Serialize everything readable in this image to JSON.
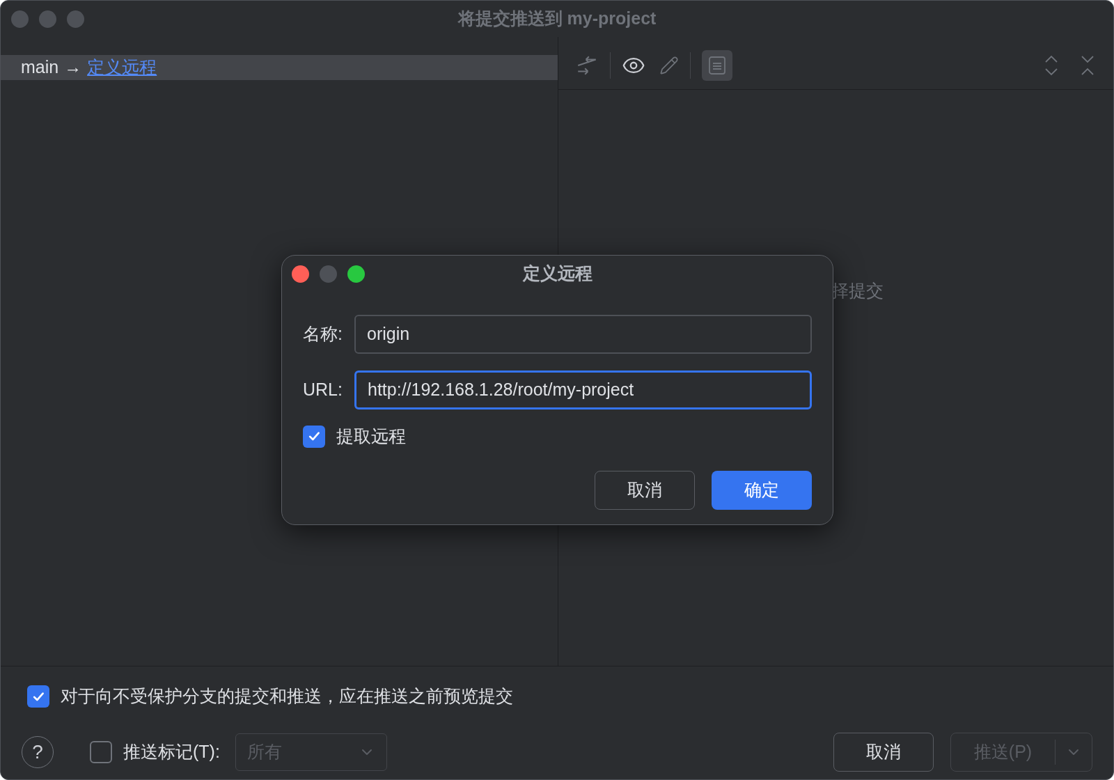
{
  "window": {
    "title": "将提交推送到 my-project"
  },
  "push_tree": {
    "rows": [
      {
        "branch": "main",
        "arrow": "→",
        "target": "定义远程",
        "selected": true
      }
    ]
  },
  "details_pane": {
    "details_toggle": {
      "on": true
    },
    "placeholder_text": "择提交"
  },
  "dialog": {
    "title": "定义远程",
    "fields": [
      {
        "label": "名称:",
        "value": "origin",
        "focused": false
      },
      {
        "label": "URL:",
        "value": "http://192.168.1.28/root/my-project",
        "focused": true
      }
    ],
    "fetch_checkbox": {
      "label": "提取远程",
      "checked": true
    },
    "buttons": [
      {
        "label": "取消",
        "kind": "secondary"
      },
      {
        "label": "确定",
        "kind": "primary"
      }
    ]
  },
  "footer": {
    "preview_checkbox": {
      "label": "对于向不受保护分支的提交和推送，应在推送之前预览提交",
      "checked": true
    },
    "help": "?",
    "push_tags": {
      "label": "推送标记(T):",
      "checked": false
    },
    "tags_select": {
      "value": "所有",
      "disabled": true
    },
    "cancel_button": {
      "label": "取消"
    },
    "push_button": {
      "label": "推送(P)",
      "disabled": true
    }
  }
}
